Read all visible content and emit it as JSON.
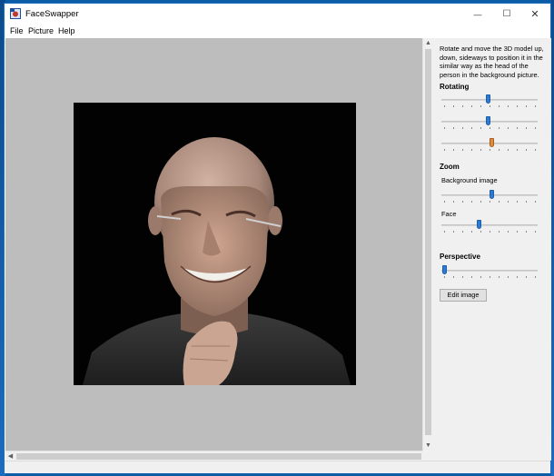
{
  "window": {
    "title": "FaceSwapper",
    "minimize_glyph": "—",
    "maximize_glyph": "☐",
    "close_glyph": "✕"
  },
  "menu": [
    "File",
    "Picture",
    "Help"
  ],
  "side": {
    "instructions": "Rotate and move the 3D model up, down, sideways to position it in the similar way as the head of the person in the background picture.",
    "rotating_label": "Rotating",
    "zoom_label": "Zoom",
    "background_image_label": "Background image",
    "face_label": "Face",
    "perspective_label": "Perspective",
    "edit_button": "Edit image"
  },
  "sliders": {
    "rotate_1": 0.48,
    "rotate_2": 0.48,
    "rotate_3": 0.52,
    "zoom_background": 0.52,
    "zoom_face": 0.38,
    "perspective": 0.0
  },
  "colors": {
    "slider_thumb": "#2a7ad6",
    "active_thumb": "#e08a3c",
    "canvas_bg": "#bdbdbd"
  }
}
